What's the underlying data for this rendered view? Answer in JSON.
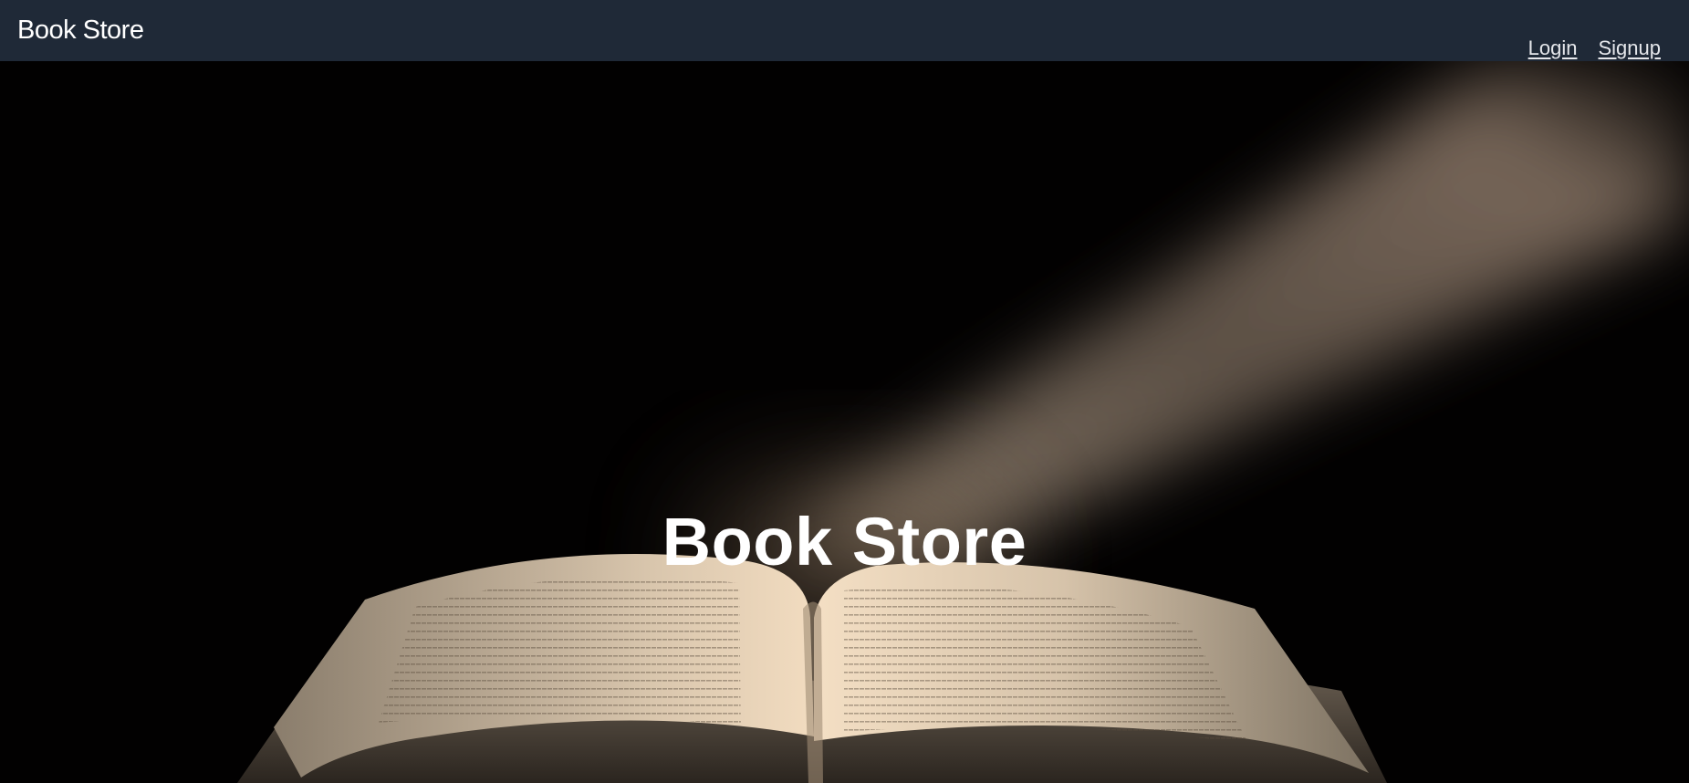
{
  "navbar": {
    "brand": "Book Store",
    "links": [
      {
        "label": "Login"
      },
      {
        "label": "Signup"
      }
    ]
  },
  "hero": {
    "title": "Book Store",
    "background_image": "open-book-under-light-beam"
  },
  "colors": {
    "navbar_bg": "#1f2937",
    "hero_bg": "#020101",
    "text": "#ffffff"
  }
}
